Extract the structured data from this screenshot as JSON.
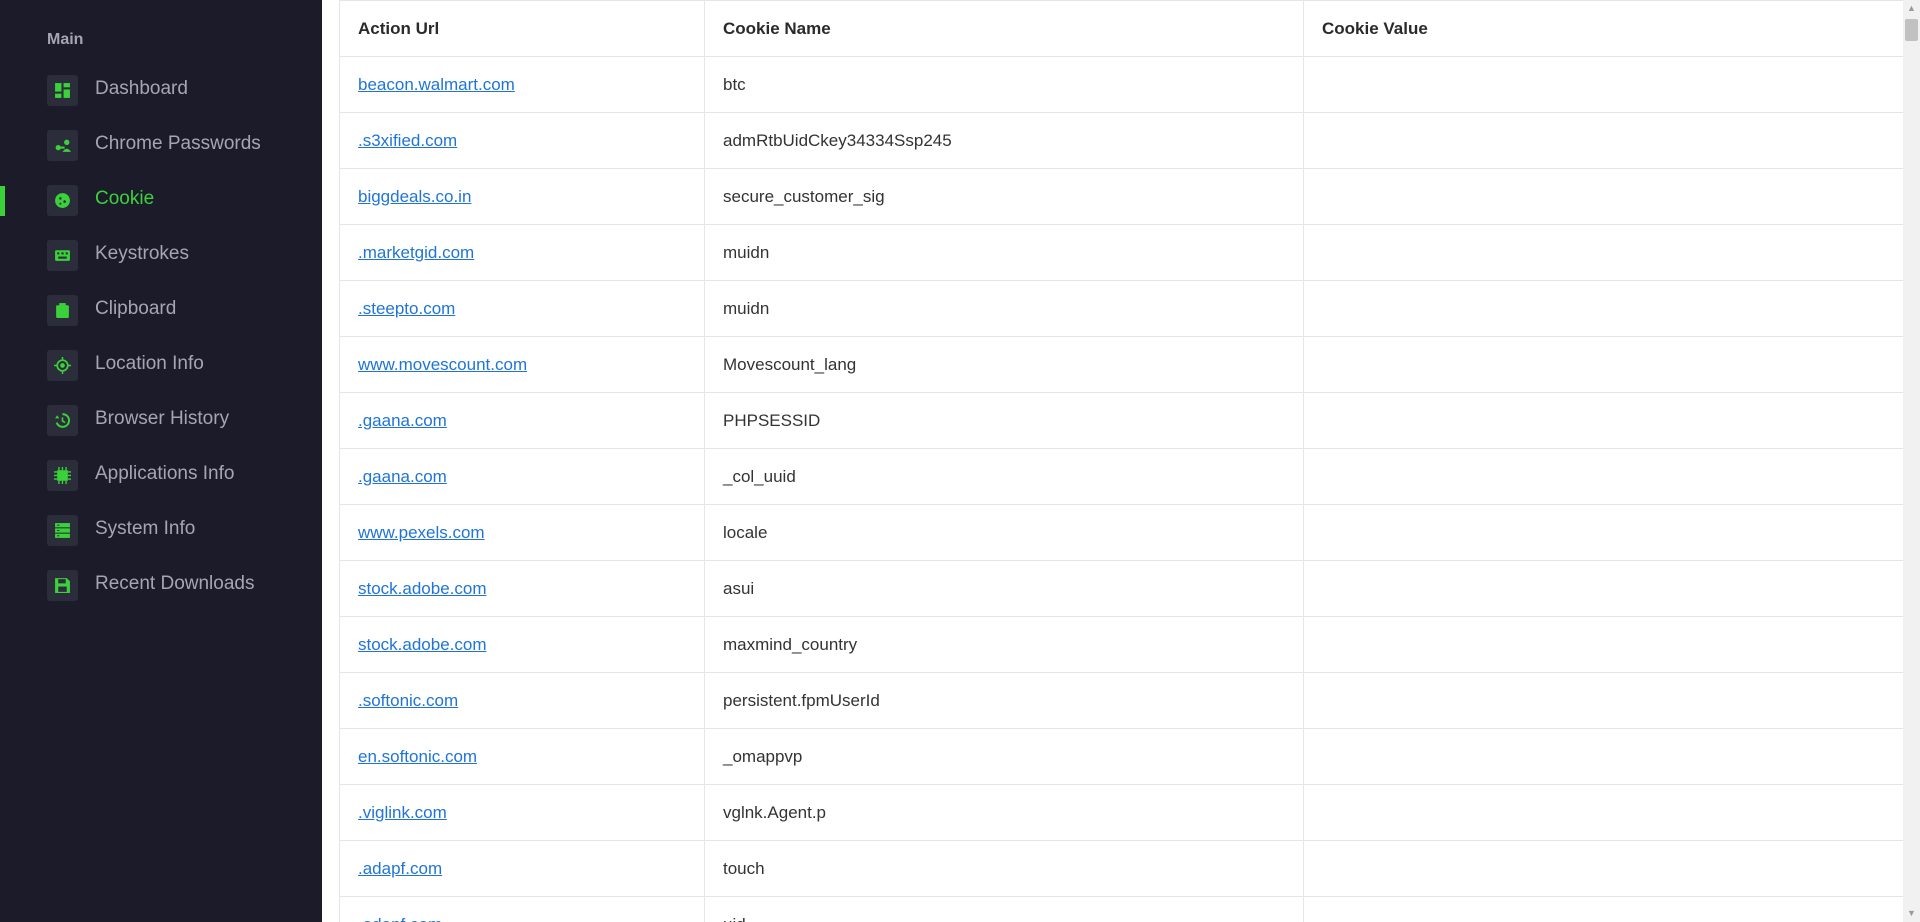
{
  "sidebar": {
    "section_title": "Main",
    "accent_color": "#3bd13b",
    "items": [
      {
        "label": "Dashboard",
        "icon": "dashboard-icon",
        "active": false
      },
      {
        "label": "Chrome Passwords",
        "icon": "key-user-icon",
        "active": false
      },
      {
        "label": "Cookie",
        "icon": "cookie-icon",
        "active": true
      },
      {
        "label": "Keystrokes",
        "icon": "keyboard-icon",
        "active": false
      },
      {
        "label": "Clipboard",
        "icon": "clipboard-icon",
        "active": false
      },
      {
        "label": "Location Info",
        "icon": "location-icon",
        "active": false
      },
      {
        "label": "Browser History",
        "icon": "history-icon",
        "active": false
      },
      {
        "label": "Applications Info",
        "icon": "chip-icon",
        "active": false
      },
      {
        "label": "System Info",
        "icon": "server-icon",
        "active": false
      },
      {
        "label": "Recent Downloads",
        "icon": "save-icon",
        "active": false
      }
    ]
  },
  "table": {
    "columns": [
      "Action Url",
      "Cookie Name",
      "Cookie Value"
    ],
    "rows": [
      {
        "url": "beacon.walmart.com",
        "name": "btc",
        "value": ""
      },
      {
        "url": ".s3xified.com",
        "name": "admRtbUidCkey34334Ssp245",
        "value": ""
      },
      {
        "url": "biggdeals.co.in",
        "name": "secure_customer_sig",
        "value": ""
      },
      {
        "url": ".marketgid.com",
        "name": "muidn",
        "value": ""
      },
      {
        "url": ".steepto.com",
        "name": "muidn",
        "value": ""
      },
      {
        "url": "www.movescount.com",
        "name": "Movescount_lang",
        "value": ""
      },
      {
        "url": ".gaana.com",
        "name": "PHPSESSID",
        "value": ""
      },
      {
        "url": ".gaana.com",
        "name": "_col_uuid",
        "value": ""
      },
      {
        "url": "www.pexels.com",
        "name": "locale",
        "value": ""
      },
      {
        "url": "stock.adobe.com",
        "name": "asui",
        "value": ""
      },
      {
        "url": "stock.adobe.com",
        "name": "maxmind_country",
        "value": ""
      },
      {
        "url": ".softonic.com",
        "name": "persistent.fpmUserId",
        "value": ""
      },
      {
        "url": "en.softonic.com",
        "name": "_omappvp",
        "value": ""
      },
      {
        "url": ".viglink.com",
        "name": "vglnk.Agent.p",
        "value": ""
      },
      {
        "url": ".adapf.com",
        "name": "touch",
        "value": ""
      },
      {
        "url": ".adapf.com",
        "name": "uid",
        "value": ""
      }
    ]
  }
}
